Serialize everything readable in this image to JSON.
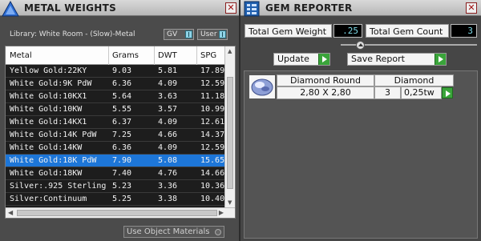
{
  "metal_panel": {
    "title": "METAL WEIGHTS",
    "library_label": "Library: White Room - (Slow)-Metal",
    "gv_toggle": "GV",
    "user_toggle": "User",
    "columns": [
      "Metal",
      "Grams",
      "DWT",
      "SPG"
    ],
    "rows": [
      [
        "Yellow Gold:22KY",
        "9.03",
        "5.81",
        "17.89"
      ],
      [
        "White Gold:9K PdW",
        "6.36",
        "4.09",
        "12.59"
      ],
      [
        "White Gold:10KX1",
        "5.64",
        "3.63",
        "11.18"
      ],
      [
        "White Gold:10KW",
        "5.55",
        "3.57",
        "10.99"
      ],
      [
        "White Gold:14KX1",
        "6.37",
        "4.09",
        "12.61"
      ],
      [
        "White Gold:14K PdW",
        "7.25",
        "4.66",
        "14.37"
      ],
      [
        "White Gold:14KW",
        "6.36",
        "4.09",
        "12.59"
      ],
      [
        "White Gold:18K PdW",
        "7.90",
        "5.08",
        "15.65"
      ],
      [
        "White Gold:18KW",
        "7.40",
        "4.76",
        "14.66"
      ],
      [
        "Silver:.925 Sterling",
        "5.23",
        "3.36",
        "10.36"
      ],
      [
        "Silver:Continuum",
        "5.25",
        "3.38",
        "10.40"
      ]
    ],
    "selected_row": 7,
    "use_object_materials": "Use Object Materials"
  },
  "gem_panel": {
    "title": "GEM REPORTER",
    "total_gem_weight_label": "Total Gem Weight",
    "total_gem_weight_value": ".25",
    "total_gem_count_label": "Total Gem Count",
    "total_gem_count_value": "3",
    "update_button": "Update",
    "save_report_button": "Save Report",
    "gem": {
      "shape": "Diamond Round",
      "material": "Diamond",
      "size": "2,80 X 2,80",
      "count": "3",
      "weight": "0,25tw"
    }
  },
  "colors": {
    "selection": "#1d76d8",
    "accent_cyan": "#7fdbe8",
    "go_green": "#3aa43a",
    "close_red": "#a01010"
  },
  "icons": [
    "app-logo-icon",
    "gem-reporter-icon",
    "close-icon",
    "go-arrow-icon",
    "diamond-thumbnail-icon"
  ]
}
